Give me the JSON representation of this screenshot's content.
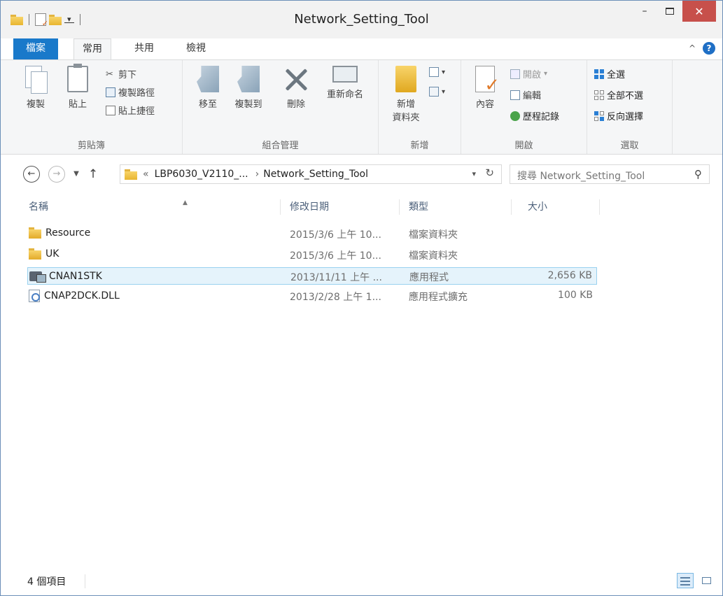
{
  "window": {
    "title": "Network_Setting_Tool",
    "minimize_label": "–",
    "close_label": "✕"
  },
  "tabs": {
    "file": "檔案",
    "home": "常用",
    "share": "共用",
    "view": "檢視"
  },
  "ribbon": {
    "clipboard": {
      "label": "剪貼簿",
      "copy": "複製",
      "paste": "貼上",
      "cut": "剪下",
      "copy_path": "複製路徑",
      "paste_shortcut": "貼上捷徑"
    },
    "organize": {
      "label": "組合管理",
      "move_to": "移至",
      "copy_to": "複製到",
      "delete": "刪除",
      "rename": "重新命名"
    },
    "new": {
      "label": "新增",
      "new_folder_line1": "新增",
      "new_folder_line2": "資料夾"
    },
    "open": {
      "label": "開啟",
      "properties": "內容",
      "open": "開啟",
      "edit": "編輯",
      "history": "歷程記錄"
    },
    "select": {
      "label": "選取",
      "select_all": "全選",
      "select_none": "全部不選",
      "invert": "反向選擇"
    }
  },
  "address": {
    "overflow": "«",
    "crumb1": "LBP6030_V2110_...",
    "crumb2": "Network_Setting_Tool",
    "search_placeholder": "搜尋 Network_Setting_Tool"
  },
  "columns": {
    "name": "名稱",
    "date": "修改日期",
    "type": "類型",
    "size": "大小"
  },
  "files": [
    {
      "name": "Resource",
      "date": "2015/3/6 上午 10...",
      "type": "檔案資料夾",
      "size": "",
      "icon": "folder-icon"
    },
    {
      "name": "UK",
      "date": "2015/3/6 上午 10...",
      "type": "檔案資料夾",
      "size": "",
      "icon": "folder-icon"
    },
    {
      "name": "CNAN1STK",
      "date": "2013/11/11 上午 ...",
      "type": "應用程式",
      "size": "2,656 KB",
      "icon": "application-icon",
      "selected": true
    },
    {
      "name": "CNAP2DCK.DLL",
      "date": "2013/2/28 上午 1...",
      "type": "應用程式擴充",
      "size": "100 KB",
      "icon": "dll-icon"
    }
  ],
  "status": {
    "count": "4 個項目"
  },
  "colors": {
    "accent": "#1979ca",
    "selection_bg": "#e5f3fb",
    "selection_border": "#99d1ef",
    "close_button": "#c7504b"
  }
}
